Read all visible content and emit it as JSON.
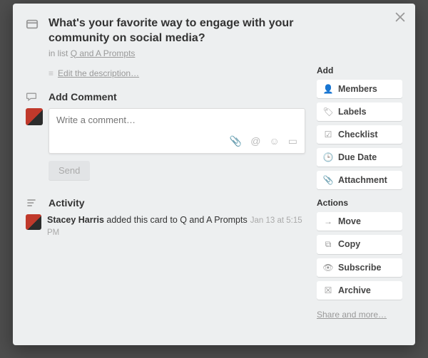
{
  "card": {
    "title": "What's your favorite way to engage with your community on social media?",
    "in_list_prefix": "in list ",
    "list_name": "Q and A Prompts",
    "edit_description": "Edit the description…"
  },
  "comment": {
    "heading": "Add Comment",
    "placeholder": "Write a comment…",
    "send_label": "Send"
  },
  "activity": {
    "heading": "Activity",
    "items": [
      {
        "user": "Stacey Harris",
        "action": " added this card to Q and A Prompts",
        "meta": "Jan 13 at 5:15 PM"
      }
    ]
  },
  "sidebar": {
    "add_heading": "Add",
    "add": [
      {
        "icon": "👤",
        "label": "Members"
      },
      {
        "icon": "🏷",
        "label": "Labels"
      },
      {
        "icon": "☑",
        "label": "Checklist"
      },
      {
        "icon": "🕒",
        "label": "Due Date"
      },
      {
        "icon": "📎",
        "label": "Attachment"
      }
    ],
    "actions_heading": "Actions",
    "actions": [
      {
        "icon": "→",
        "label": "Move"
      },
      {
        "icon": "⧉",
        "label": "Copy"
      },
      {
        "icon": "👁",
        "label": "Subscribe"
      },
      {
        "icon": "☒",
        "label": "Archive"
      }
    ],
    "share_more": "Share and more…"
  }
}
